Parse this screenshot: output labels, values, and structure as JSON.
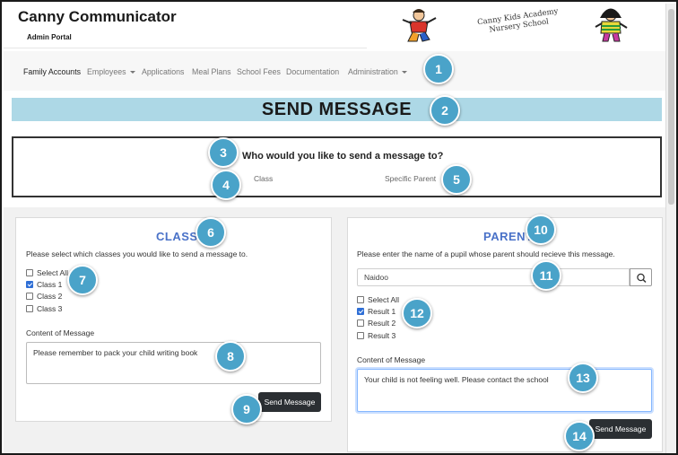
{
  "app": {
    "title": "Canny Communicator",
    "subtitle": "Admin Portal",
    "logo_text_line1": "Canny Kids Academy",
    "logo_text_line2": "Nursery School"
  },
  "nav": {
    "items": [
      {
        "label": "Family Accounts",
        "active": true,
        "dropdown": false
      },
      {
        "label": "Employees",
        "active": false,
        "dropdown": true
      },
      {
        "label": "Applications",
        "active": false,
        "dropdown": false
      },
      {
        "label": "Meal Plans",
        "active": false,
        "dropdown": false
      },
      {
        "label": "School Fees",
        "active": false,
        "dropdown": false
      },
      {
        "label": "Documentation",
        "active": false,
        "dropdown": false
      },
      {
        "label": "Administration",
        "active": false,
        "dropdown": true
      }
    ]
  },
  "page": {
    "title": "SEND MESSAGE"
  },
  "recipient_choice": {
    "question": "Who would you like to send a message to?",
    "option_class": "Class",
    "option_parent": "Specific Parent"
  },
  "class_card": {
    "title": "CLASS",
    "instructions": "Please select which classes you would like to send a message to.",
    "options": [
      {
        "label": "Select All",
        "checked": false
      },
      {
        "label": "Class 1",
        "checked": true
      },
      {
        "label": "Class 2",
        "checked": false
      },
      {
        "label": "Class 3",
        "checked": false
      }
    ],
    "content_label": "Content of Message",
    "message": "Please remember to pack your child writing book",
    "send_label": "Send Message"
  },
  "parent_card": {
    "title": "PARENT",
    "instructions": "Please enter the name of a pupil whose parent should recieve this message.",
    "search_value": "Naidoo",
    "search_icon": "search-icon",
    "options": [
      {
        "label": "Select All",
        "checked": false
      },
      {
        "label": "Result 1",
        "checked": true
      },
      {
        "label": "Result 2",
        "checked": false
      },
      {
        "label": "Result 3",
        "checked": false
      }
    ],
    "content_label": "Content of Message",
    "message": "Your child is not feeling well. Please contact the school",
    "send_label": "Send Message"
  },
  "markers": [
    "1",
    "2",
    "3",
    "4",
    "5",
    "6",
    "7",
    "8",
    "9",
    "10",
    "11",
    "12",
    "13",
    "14"
  ],
  "colors": {
    "title_bar": "#add8e6",
    "card_title": "#4a72c8",
    "marker": "#4aa3c9",
    "button": "#2b2f33",
    "checkbox_checked": "#2f6fd6"
  }
}
